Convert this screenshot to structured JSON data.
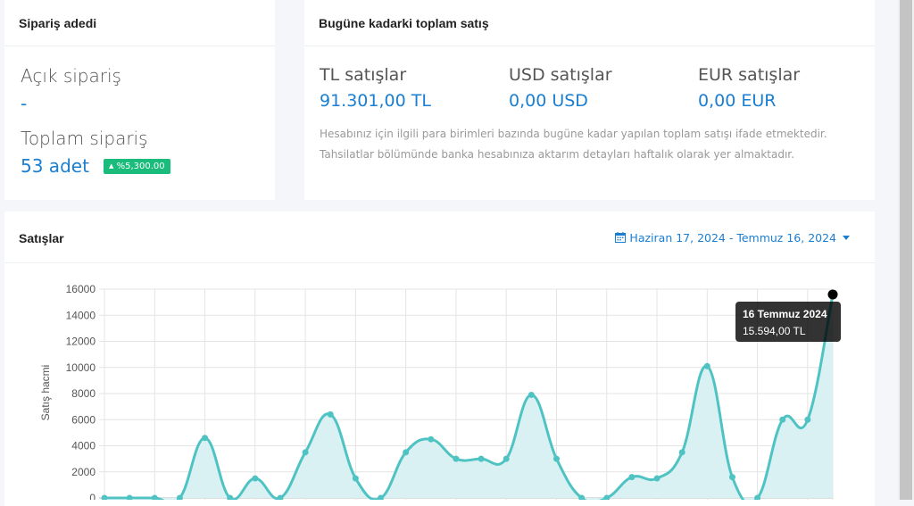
{
  "orders": {
    "title": "Sipariş adedi",
    "open_label": "Açık sipariş",
    "open_value": "-",
    "total_label": "Toplam sipariş",
    "total_value": "53 adet",
    "badge_arrow": "▲",
    "badge_value": "%5,300.00"
  },
  "total_sales": {
    "title": "Bugüne kadarki toplam satış",
    "currencies": [
      {
        "label": "TL satışlar",
        "value": "91.301,00 TL"
      },
      {
        "label": "USD satışlar",
        "value": "0,00 USD"
      },
      {
        "label": "EUR satışlar",
        "value": "0,00 EUR"
      }
    ],
    "info_line1": "Hesabınız için ilgili para birimleri bazında bugüne kadar yapılan toplam satışı ifade etmektedir.",
    "info_line2": "Tahsilatlar bölümünde banka hesabınıza aktarım detayları haftalık olarak yer almaktadır."
  },
  "sales": {
    "title": "Satışlar",
    "date_range": "Haziran 17, 2024 - Temmuz 16, 2024",
    "date_icon": "calendar-icon",
    "caret_icon": "caret-down-icon"
  },
  "tooltip": {
    "title": "16 Temmuz 2024",
    "body": "15.594,00 TL"
  },
  "colors": {
    "accent": "#1a7ed1",
    "line": "#4fc3c3",
    "fill": "#d9f1f2",
    "badge": "#1abc7b"
  },
  "chart_data": {
    "type": "area",
    "ylabel": "Satış hacmi",
    "xlabel": "",
    "ylim": [
      0,
      16000
    ],
    "yticks": [
      0,
      2000,
      4000,
      6000,
      8000,
      10000,
      12000,
      14000,
      16000
    ],
    "grid": true,
    "series": [
      {
        "values": [
          0,
          0,
          0,
          0,
          4600,
          0,
          1500,
          0,
          3500,
          6400,
          1500,
          0,
          3500,
          4500,
          3000,
          3000,
          3000,
          7900,
          3000,
          0,
          0,
          1600,
          1500,
          3500,
          10100,
          1600,
          0,
          6000,
          6000,
          15594
        ]
      }
    ]
  }
}
